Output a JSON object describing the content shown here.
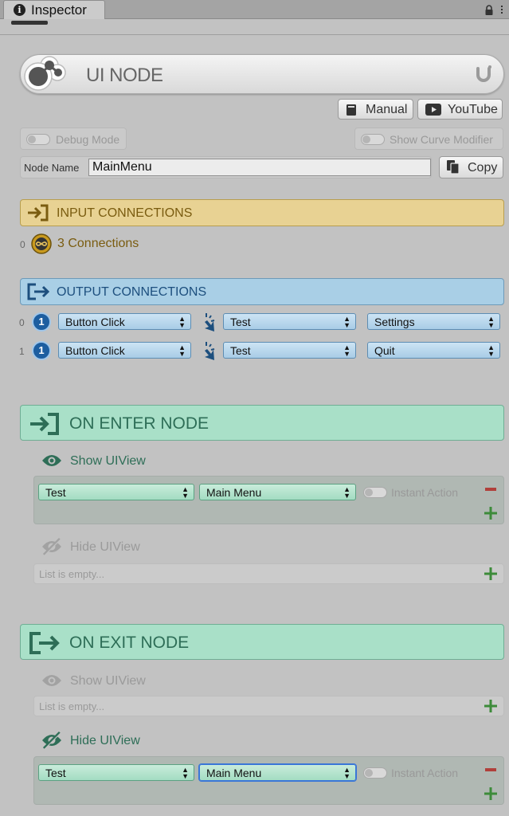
{
  "window": {
    "tab_title": "Inspector"
  },
  "header": {
    "title": "UI NODE"
  },
  "links": {
    "manual_label": "Manual",
    "youtube_label": "YouTube"
  },
  "options": {
    "debug_mode_label": "Debug Mode",
    "curve_modifier_label": "Show Curve Modifier"
  },
  "node_name": {
    "label": "Node Name",
    "value": "MainMenu",
    "copy_label": "Copy"
  },
  "input_connections": {
    "title": "INPUT CONNECTIONS",
    "index": "0",
    "summary": "3 Connections"
  },
  "output_connections": {
    "title": "OUTPUT CONNECTIONS",
    "rows": [
      {
        "index": "0",
        "badge": "1",
        "trigger": "Button Click",
        "category": "Test",
        "name": "Settings"
      },
      {
        "index": "1",
        "badge": "1",
        "trigger": "Button Click",
        "category": "Test",
        "name": "Quit"
      }
    ]
  },
  "on_enter": {
    "title": "ON ENTER NODE",
    "show_title": "Show UIView",
    "show_items": [
      {
        "category": "Test",
        "name": "Main Menu",
        "instant_label": "Instant Action"
      }
    ],
    "hide_title": "Hide UIView",
    "hide_empty": "List is empty..."
  },
  "on_exit": {
    "title": "ON EXIT NODE",
    "show_title": "Show UIView",
    "show_empty": "List is empty...",
    "hide_title": "Hide UIView",
    "hide_items": [
      {
        "category": "Test",
        "name": "Main Menu",
        "instant_label": "Instant Action"
      }
    ]
  },
  "colors": {
    "input_accent": "#7a5c10",
    "output_accent": "#1d4f7e",
    "node_accent": "#2e6e57",
    "add": "#3d8b3a",
    "remove": "#b0403b"
  },
  "icons": {
    "tab": "info-icon",
    "lock": "lock-icon",
    "input": "sign-in-icon",
    "output": "sign-out-icon",
    "connections": "infinity-icon",
    "trigger": "pointer-click-icon",
    "show": "eye-icon",
    "hide": "eye-slash-icon"
  }
}
